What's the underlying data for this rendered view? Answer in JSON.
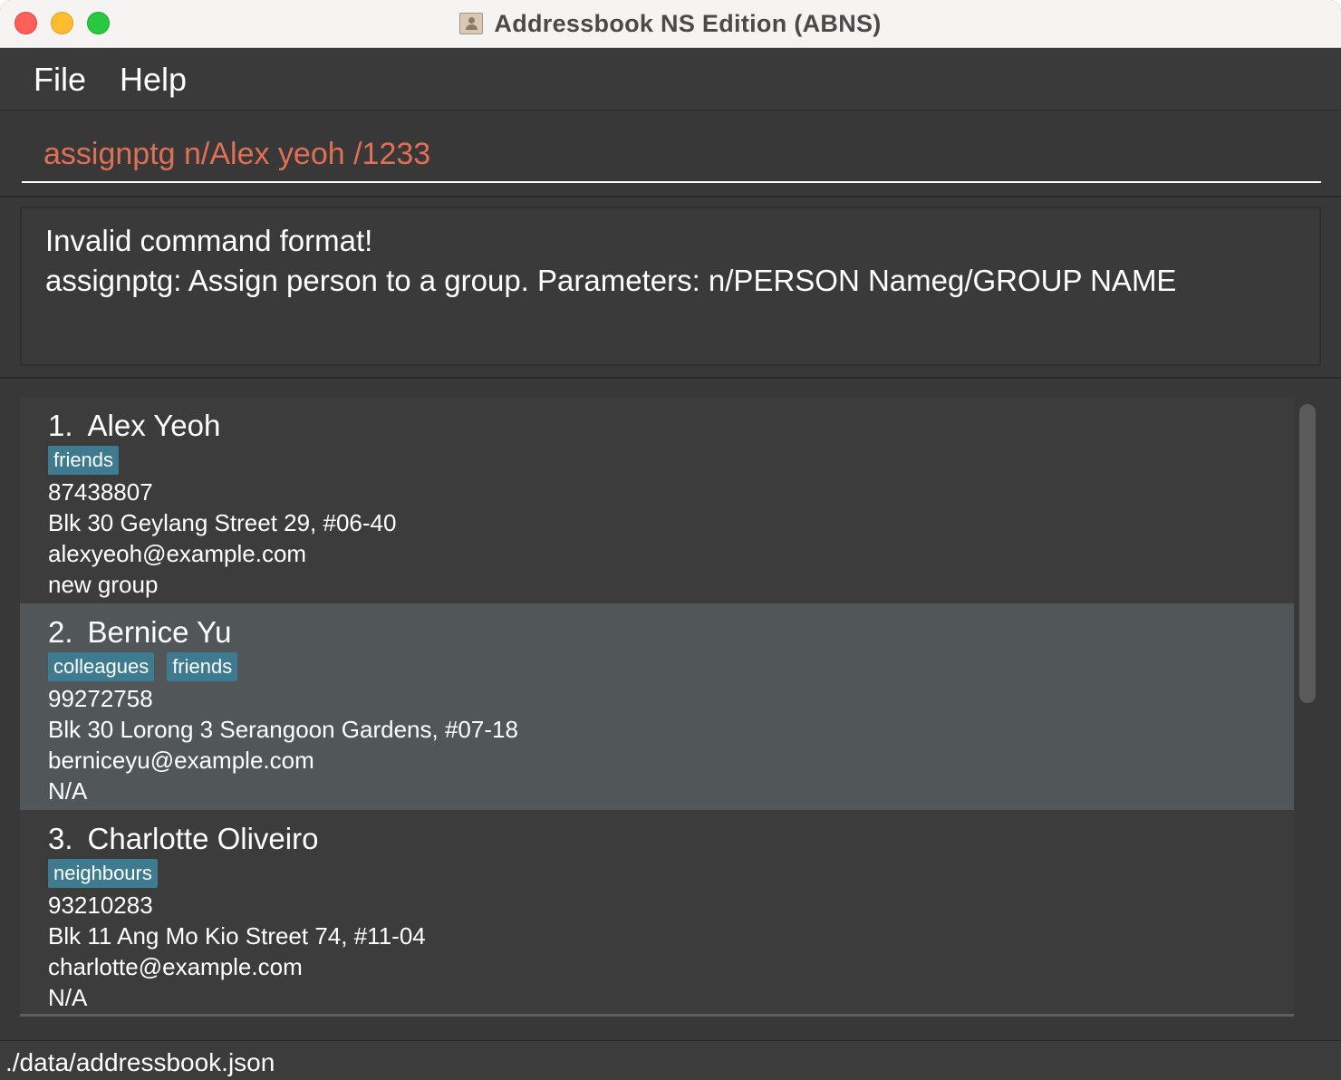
{
  "window": {
    "title": "Addressbook NS Edition (ABNS)"
  },
  "menu": {
    "file": "File",
    "help": "Help"
  },
  "command": {
    "value": "assignptg n/Alex yeoh /1233"
  },
  "result": {
    "line1": "Invalid command format!",
    "line2": "assignptg: Assign person to a group. Parameters: n/PERSON Nameg/GROUP NAME"
  },
  "persons": [
    {
      "index": "1.",
      "name": "Alex Yeoh",
      "tags": [
        "friends"
      ],
      "phone": "87438807",
      "address": "Blk 30 Geylang Street 29, #06-40",
      "email": "alexyeoh@example.com",
      "group": "new group"
    },
    {
      "index": "2.",
      "name": "Bernice Yu",
      "tags": [
        "colleagues",
        "friends"
      ],
      "phone": "99272758",
      "address": "Blk 30 Lorong 3 Serangoon Gardens, #07-18",
      "email": "berniceyu@example.com",
      "group": "N/A"
    },
    {
      "index": "3.",
      "name": "Charlotte Oliveiro",
      "tags": [
        "neighbours"
      ],
      "phone": "93210283",
      "address": "Blk 11 Ang Mo Kio Street 74, #11-04",
      "email": "charlotte@example.com",
      "group": "N/A"
    }
  ],
  "status": {
    "path": "./data/addressbook.json"
  },
  "colors": {
    "command_text": "#e07055",
    "tag_bg": "#3e7b91",
    "selected_card_bg": "#515658"
  }
}
